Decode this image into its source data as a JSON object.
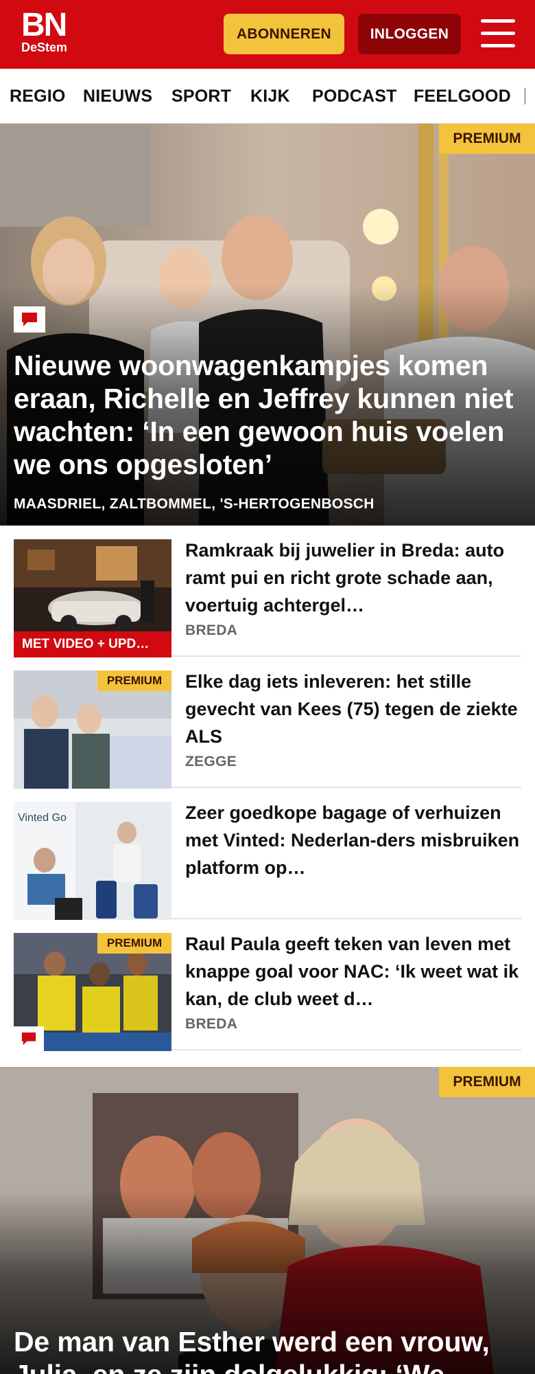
{
  "header": {
    "logo_main": "BN",
    "logo_sub": "DeStem",
    "subscribe_label": "ABONNEREN",
    "login_label": "INLOGGEN",
    "menu_icon": "hamburger-menu-icon",
    "background_color": "#d10a11"
  },
  "nav": {
    "items": [
      "REGIO",
      "NIEUWS",
      "SPORT",
      "KIJK",
      "PODCAST",
      "FEELGOOD"
    ]
  },
  "hero": {
    "badge": "PREMIUM",
    "title": "Nieuwe woonwagenkampjes komen eraan, Richelle en Jeffrey kunnen niet wachten: ‘In een gewoon huis voelen we ons opgesloten’",
    "location": "MAASDRIEL, ZALTBOMMEL, 'S-HERTOGENBOSCH",
    "has_comments": true
  },
  "articles": [
    {
      "title": "Ramkraak bij juwelier in Breda: auto ramt pui en richt grote schade aan, voertuig achtergel…",
      "location": "BREDA",
      "label": "MET VIDEO + UPD…"
    },
    {
      "title": "Elke dag iets inleveren: het stille gevecht van Kees (75) tegen de ziekte ALS",
      "location": "ZEGGE",
      "badge": "PREMIUM"
    },
    {
      "title": "Zeer goedkope bagage of verhuizen met Vinted: Nederlan-ders misbruiken platform op…",
      "location": ""
    },
    {
      "title": "Raul Paula geeft teken van leven met knappe goal voor NAC: ‘Ik weet wat ik kan, de club weet d…",
      "location": "BREDA",
      "badge": "PREMIUM"
    }
  ],
  "hero2": {
    "badge": "PREMIUM",
    "title": "De man van Esther werd een vrouw, Julia, en ze zijn dolgelukkig: ‘We…"
  },
  "colors": {
    "brand_red": "#d10a11",
    "premium_yellow": "#f4c33c",
    "login_dark_red": "#8e0308"
  }
}
